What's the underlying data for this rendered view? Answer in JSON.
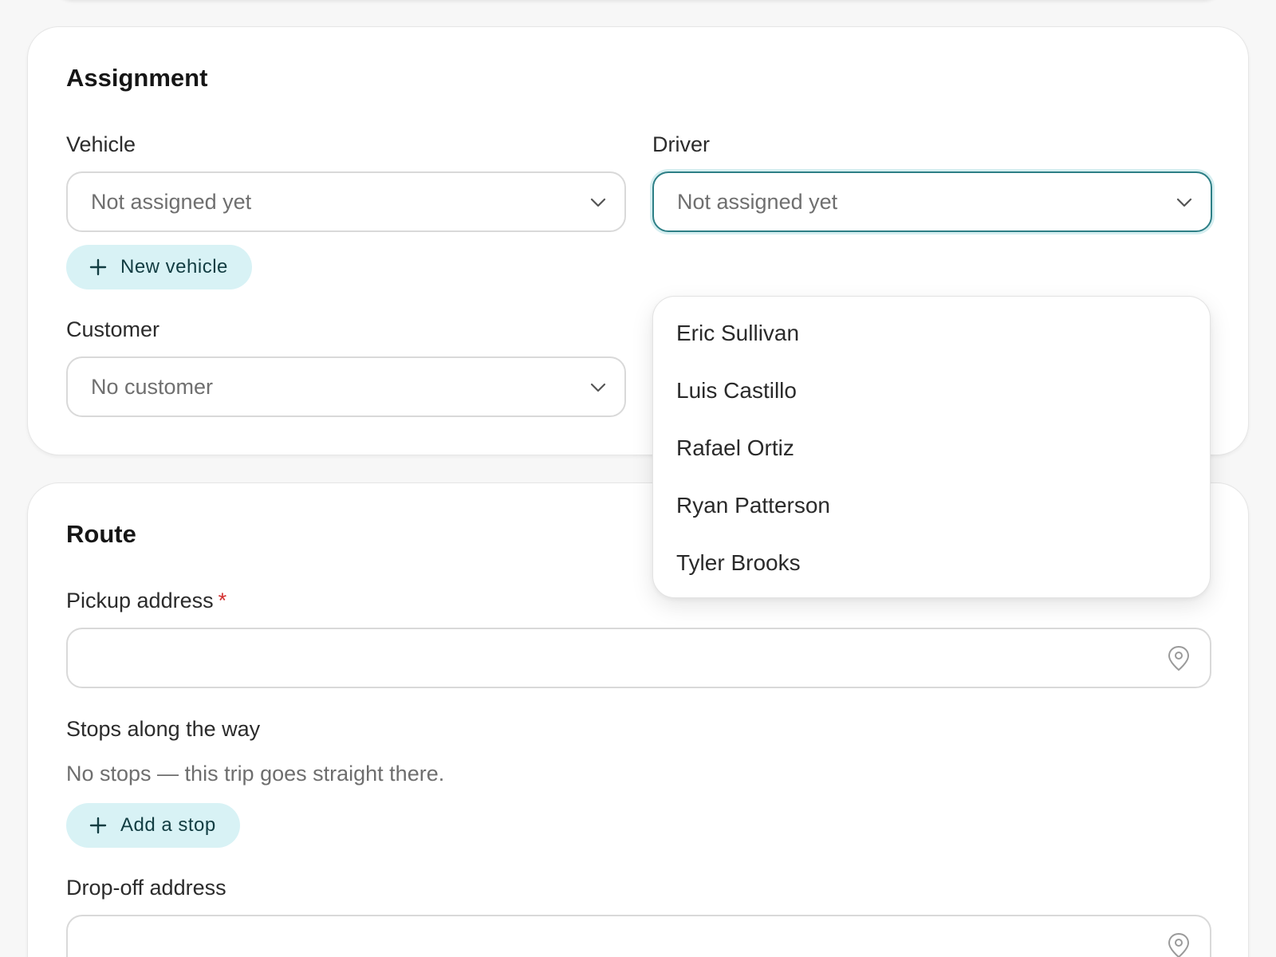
{
  "assignment": {
    "title": "Assignment",
    "vehicle": {
      "label": "Vehicle",
      "value": "Not assigned yet"
    },
    "driver": {
      "label": "Driver",
      "value": "Not assigned yet",
      "options": [
        "Eric Sullivan",
        "Luis Castillo",
        "Rafael Ortiz",
        "Ryan Patterson",
        "Tyler Brooks"
      ]
    },
    "new_vehicle_label": "New vehicle",
    "customer": {
      "label": "Customer",
      "value": "No customer"
    }
  },
  "route": {
    "title": "Route",
    "pickup": {
      "label": "Pickup address",
      "required_mark": "*",
      "value": "",
      "icon": "map-pin-icon"
    },
    "stops": {
      "label": "Stops along the way",
      "empty_text": "No stops — this trip goes straight there.",
      "add_label": "Add a stop"
    },
    "dropoff": {
      "label": "Drop-off address",
      "value": "",
      "icon": "map-pin-icon"
    }
  },
  "colors": {
    "accent": "#2d7f86",
    "pill_bg": "#d8f2f5",
    "required": "#d32f2f"
  }
}
